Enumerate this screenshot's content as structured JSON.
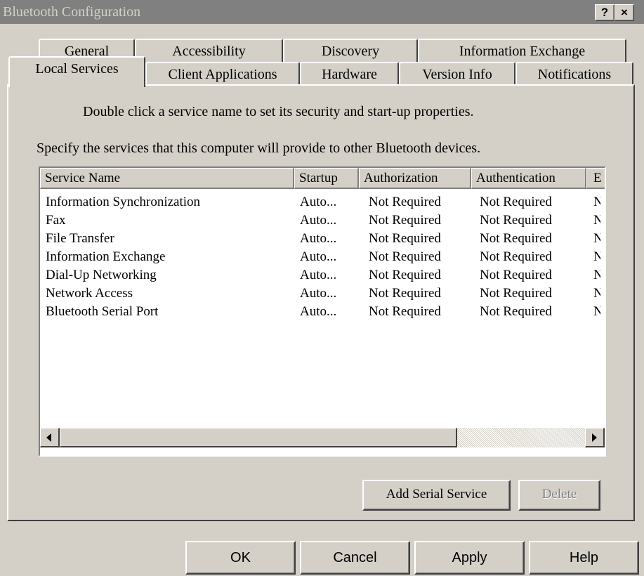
{
  "window": {
    "title": "Bluetooth Configuration",
    "help_button": "?",
    "close_button": "×"
  },
  "tabs": {
    "back_row": [
      "General",
      "Accessibility",
      "Discovery",
      "Information Exchange"
    ],
    "front_row": [
      "Local Services",
      "Client Applications",
      "Hardware",
      "Version Info",
      "Notifications"
    ],
    "active": "Local Services"
  },
  "instructions": {
    "line1": "Double click a service name to set its security and start-up properties.",
    "line2": "Specify the services that this computer will provide to other Bluetooth devices."
  },
  "services_list": {
    "columns": [
      "Service Name",
      "Startup",
      "Authorization",
      "Authentication",
      "E"
    ],
    "rows": [
      [
        "Information Synchronization",
        "Auto...",
        "Not Required",
        "Not Required",
        "N"
      ],
      [
        "Fax",
        "Auto...",
        "Not Required",
        "Not Required",
        "N"
      ],
      [
        "File Transfer",
        "Auto...",
        "Not Required",
        "Not Required",
        "N"
      ],
      [
        "Information Exchange",
        "Auto...",
        "Not Required",
        "Not Required",
        "N"
      ],
      [
        "Dial-Up Networking",
        "Auto...",
        "Not Required",
        "Not Required",
        "N"
      ],
      [
        "Network Access",
        "Auto...",
        "Not Required",
        "Not Required",
        "N"
      ],
      [
        "Bluetooth Serial Port",
        "Auto...",
        "Not Required",
        "Not Required",
        "N"
      ]
    ]
  },
  "panel_buttons": {
    "add_serial_service": "Add Serial Service",
    "delete": "Delete"
  },
  "dialog_buttons": {
    "ok": "OK",
    "cancel": "Cancel",
    "apply": "Apply",
    "help": "Help"
  }
}
